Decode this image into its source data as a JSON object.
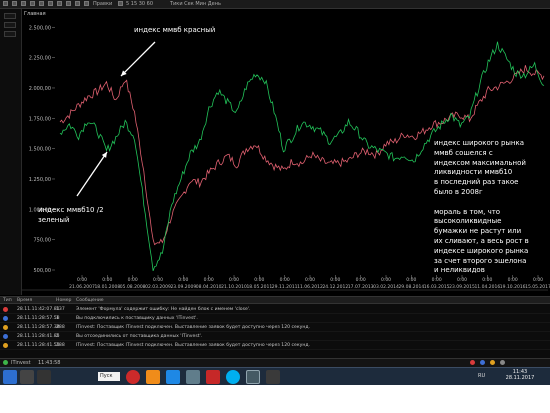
{
  "toolbar": {
    "menu_label": "Правки",
    "time_label": "5 15 30 60",
    "view_label": "Тики Сек Мин День"
  },
  "tab": {
    "label": "Главная"
  },
  "chart_data": {
    "type": "line",
    "y_ticks": [
      "2.500,00",
      "2.250,00",
      "2.000,00",
      "1.750,00",
      "1.500,00",
      "1.250,00",
      "1.000,00",
      "750,00",
      "500,00"
    ],
    "ylim": [
      500,
      2500
    ],
    "x_labels": [
      {
        "time": "0:00",
        "date": "21.06.2007"
      },
      {
        "time": "0:00",
        "date": "18.01.2008"
      },
      {
        "time": "0:00",
        "date": "05.08.2008"
      },
      {
        "time": "0:00",
        "date": "02.03.2009"
      },
      {
        "time": "0:00",
        "date": "23.09.2009"
      },
      {
        "time": "0:00",
        "date": "08.04.2010"
      },
      {
        "time": "0:00",
        "date": "21.10.2010"
      },
      {
        "time": "0:00",
        "date": "18.05.2011"
      },
      {
        "time": "0:00",
        "date": "29.11.2011"
      },
      {
        "time": "0:00",
        "date": "11.06.2012"
      },
      {
        "time": "0:00",
        "date": "24.12.2012"
      },
      {
        "time": "0:00",
        "date": "17.07.2013"
      },
      {
        "time": "0:00",
        "date": "03.02.2014"
      },
      {
        "time": "0:00",
        "date": "29.08.2014"
      },
      {
        "time": "0:00",
        "date": "16.03.2015"
      },
      {
        "time": "0:00",
        "date": "23.09.2015"
      },
      {
        "time": "0:00",
        "date": "11.04.2016"
      },
      {
        "time": "0:00",
        "date": "19.10.2016"
      },
      {
        "time": "0:00",
        "date": "15.05.2017"
      }
    ],
    "series": [
      {
        "color": "#e06070",
        "values": [
          1720,
          1780,
          1860,
          1930,
          1970,
          2040,
          1900,
          2080,
          1800,
          1320,
          720,
          730,
          950,
          1090,
          1240,
          1220,
          1300,
          1380,
          1440,
          1370,
          1500,
          1540,
          1430,
          1360,
          1320,
          1400,
          1380,
          1450,
          1400,
          1370,
          1380,
          1400,
          1460,
          1480,
          1450,
          1540,
          1560,
          1620,
          1600,
          1640,
          1700,
          1720,
          1760,
          1780,
          1740,
          1870,
          1980,
          2010,
          2050,
          2100,
          2160,
          2120,
          2100
        ]
      },
      {
        "color": "#22c45a",
        "values": [
          1630,
          1700,
          1610,
          1740,
          1650,
          1480,
          1590,
          1720,
          1600,
          1060,
          520,
          640,
          1040,
          1250,
          1460,
          1560,
          1830,
          1980,
          1880,
          1790,
          2010,
          2120,
          2070,
          1810,
          1500,
          1600,
          1720,
          1690,
          1640,
          1560,
          1610,
          1720,
          1640,
          1530,
          1490,
          1460,
          1420,
          1450,
          1400,
          1520,
          1620,
          1700,
          1780,
          1690,
          1760,
          2010,
          2210,
          2360,
          2240,
          2120,
          2110,
          2190,
          2020
        ]
      }
    ],
    "annotations": [
      "индекс ммвб красный",
      "индекс ммвб10 /2\nзеленый",
      "индекс широкого рынка\nммвб сошелся с\nиндексом максимальной\nликвидности ммвб10\nв последний раз такое\nбыло в 2008г\n\nмораль в том, что\nвысоколиквидные\nбумажки не растут или\nих сливают, а весь рост в\nиндексе широкого рынка\nза счет второго эшелона\nи неликвидов"
    ]
  },
  "log": {
    "headers": [
      "Тип",
      "Время",
      "Номер",
      "Сообщение"
    ],
    "rows": [
      {
        "type_color": "#d93b3b",
        "time": "28.11.11:42:07.81",
        "number": "137",
        "message": "Элемент 'Формула' содержит ошибку: Не найден блок с именем 'close'."
      },
      {
        "type_color": "#3d6fd6",
        "time": "28.11.11:28:57.58",
        "number": "1",
        "message": "Вы подключились к поставщику данных 'ITinvest'."
      },
      {
        "type_color": "#e0a020",
        "time": "28.11.11:28:57.38",
        "number": "288",
        "message": "ITinvest: Поставщик ITinvest подключен. Выставление заявок будет доступно через 120 секунд."
      },
      {
        "type_color": "#3d6fd6",
        "time": "28.11.11:28:41.85",
        "number": "2",
        "message": "Вы отсоединились от поставщика данных 'ITinvest'."
      },
      {
        "type_color": "#e0a020",
        "time": "28.11.11:28:41.55",
        "number": "288",
        "message": "ITinvest: Поставщик ITinvest подключен. Выставление заявок будет доступно через 120 секунд."
      }
    ]
  },
  "status": {
    "provider": "ITinvest",
    "clock": "11:43:58"
  },
  "taskbar": {
    "lang": "RU",
    "time": "11:43",
    "date": "28.11.2017",
    "search_label": "Пуск"
  }
}
